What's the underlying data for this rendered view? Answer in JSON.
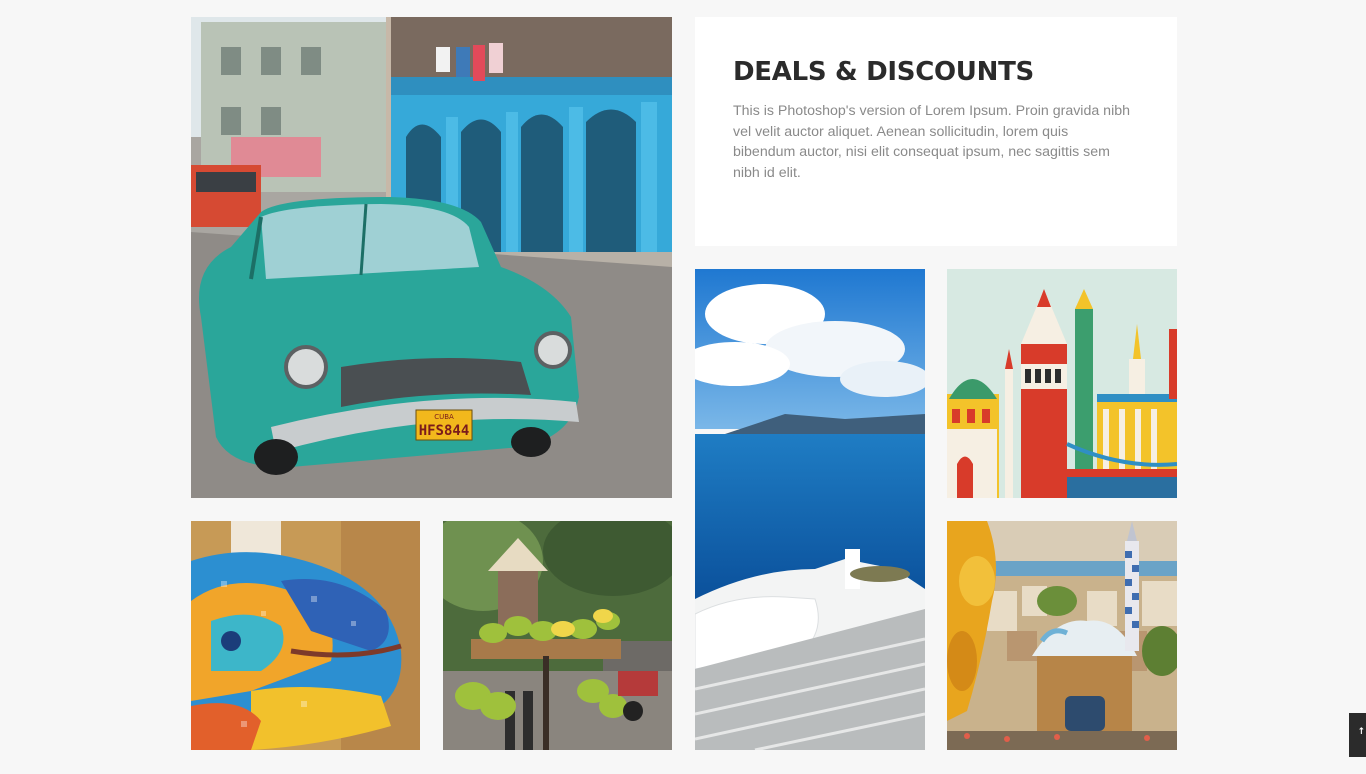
{
  "deals": {
    "title": "DEALS & DISCOUNTS",
    "description": "This is Photoshop's version of Lorem Ipsum. Proin gravida nibh vel velit auctor aliquet. Aenean sollicitudin, lorem quis bibendum auctor, nisi elit consequat ipsum, nec sagittis sem nibh id elit."
  },
  "car_plate": {
    "country": "CUBA",
    "number": "HFS844"
  },
  "back_to_top": {
    "label": "↑"
  },
  "colors": {
    "page_background": "#f7f7f7",
    "title": "#2b2b2b",
    "body_text": "#8a8a8a",
    "car_teal": "#2aa69a",
    "building_blue": "#36a9d9"
  },
  "images": [
    {
      "name": "havana-classic-car-photo"
    },
    {
      "name": "santorini-sea-view-photo"
    },
    {
      "name": "istanbul-illustration"
    },
    {
      "name": "gaudi-mosaic-lizard-photo"
    },
    {
      "name": "vietnam-fruit-vendor-photo"
    },
    {
      "name": "park-guell-barcelona-photo"
    }
  ]
}
